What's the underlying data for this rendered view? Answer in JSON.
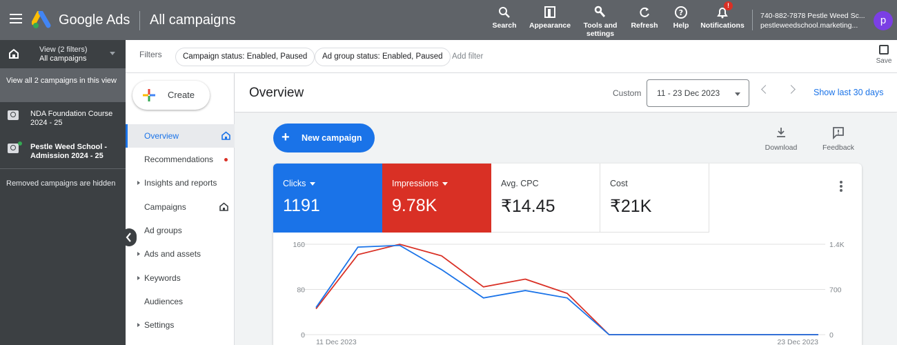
{
  "topbar": {
    "brand": "Google Ads",
    "page_title": "All campaigns",
    "buttons": [
      {
        "label": "Search",
        "icon": "search-icon"
      },
      {
        "label": "Appearance",
        "icon": "appearance-icon"
      },
      {
        "label": "Tools and settings",
        "icon": "wrench-icon"
      },
      {
        "label": "Refresh",
        "icon": "refresh-icon"
      },
      {
        "label": "Help",
        "icon": "help-icon"
      },
      {
        "label": "Notifications",
        "icon": "bell-icon",
        "badge": "!"
      }
    ],
    "account_line1": "740-882-7878 Pestle Weed Sc...",
    "account_line2": "pestleweedschool.marketing...",
    "avatar_letter": "p"
  },
  "leftpanel": {
    "view_line1": "View (2 filters)",
    "view_line2": "All campaigns",
    "view_all": "View all 2 campaigns in this view",
    "campaigns": [
      {
        "name": "NDA Foundation Course 2024 - 25"
      },
      {
        "name": "Pestle Weed School - Admission 2024 - 25"
      }
    ],
    "removed_note": "Removed campaigns are hidden"
  },
  "filters": {
    "label": "Filters",
    "chips": [
      "Campaign status: Enabled, Paused",
      "Ad group status: Enabled, Paused"
    ],
    "add_filter": "Add filter",
    "save_label": "Save"
  },
  "nav": {
    "create_label": "Create",
    "items": [
      {
        "label": "Overview"
      },
      {
        "label": "Recommendations"
      },
      {
        "label": "Insights and reports"
      },
      {
        "label": "Campaigns"
      },
      {
        "label": "Ad groups"
      },
      {
        "label": "Ads and assets"
      },
      {
        "label": "Keywords"
      },
      {
        "label": "Audiences"
      },
      {
        "label": "Settings"
      }
    ]
  },
  "overview": {
    "title": "Overview",
    "custom_label": "Custom",
    "date_range": "11 - 23 Dec 2023",
    "show_last": "Show last 30 days",
    "new_campaign": "New campaign",
    "download": "Download",
    "feedback": "Feedback",
    "metrics": [
      {
        "label": "Clicks",
        "value": "1191",
        "color": "#1a73e8"
      },
      {
        "label": "Impressions",
        "value": "9.78K",
        "color": "#d93025"
      },
      {
        "label": "Avg. CPC",
        "value": "₹14.45"
      },
      {
        "label": "Cost",
        "value": "₹21K"
      }
    ]
  },
  "chart_data": {
    "type": "line",
    "x": [
      "11 Dec 2023",
      "12 Dec 2023",
      "13 Dec 2023",
      "14 Dec 2023",
      "15 Dec 2023",
      "16 Dec 2023",
      "17 Dec 2023",
      "18 Dec 2023",
      "19 Dec 2023",
      "20 Dec 2023",
      "21 Dec 2023",
      "22 Dec 2023",
      "23 Dec 2023"
    ],
    "x_tick_labels": [
      "11 Dec 2023",
      "23 Dec 2023"
    ],
    "left_ticks": [
      "0",
      "80",
      "160"
    ],
    "right_ticks": [
      "0",
      "700",
      "1.4K"
    ],
    "ylim_left": [
      0,
      160
    ],
    "ylim_right": [
      0,
      1400
    ],
    "series": [
      {
        "name": "Clicks",
        "axis": "left",
        "color": "#1a73e8",
        "values": [
          48,
          155,
          158,
          115,
          65,
          78,
          65,
          0,
          0,
          0,
          0,
          0,
          0
        ]
      },
      {
        "name": "Impressions",
        "axis": "right",
        "color": "#d93025",
        "values": [
          400,
          1240,
          1400,
          1220,
          740,
          860,
          640,
          0,
          0,
          0,
          0,
          0,
          0
        ]
      }
    ],
    "grid": true
  }
}
